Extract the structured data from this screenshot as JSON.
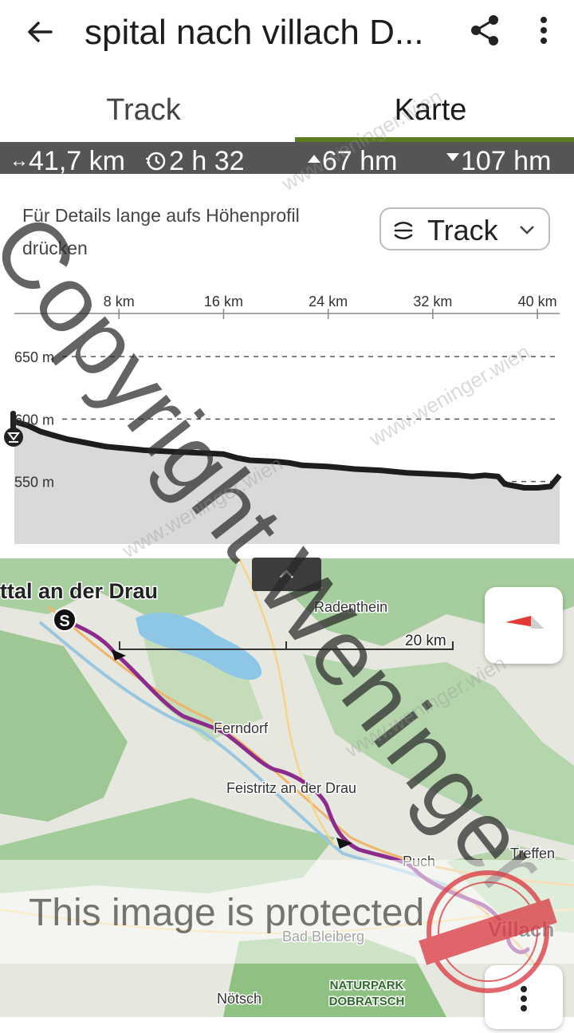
{
  "app_bar": {
    "title": "spital nach villach D...",
    "back_icon": "arrow-back-icon",
    "share_icon": "share-icon",
    "more_icon": "more-vert-icon"
  },
  "tabs": [
    {
      "label": "Track",
      "selected": false
    },
    {
      "label": "Karte",
      "selected": true
    }
  ],
  "stats": {
    "distance": "41,7 km",
    "duration": "2 h 32",
    "ascent": "67 hm",
    "descent": "107 hm"
  },
  "profile_hint": {
    "line1": "Für Details lange aufs Höhenprofil",
    "line2": "drücken"
  },
  "profile_mode": {
    "label": "Track"
  },
  "chart_data": {
    "type": "area",
    "xlabel": "",
    "ylabel": "",
    "x_unit": "km",
    "x_ticks": [
      "8 km",
      "16 km",
      "24 km",
      "32 km",
      "40 km"
    ],
    "y_ticks": [
      "650 m",
      "600 m",
      "550 m"
    ],
    "xlim": [
      0,
      41.7
    ],
    "ylim": [
      500,
      680
    ],
    "x": [
      0,
      1,
      2,
      3,
      4,
      5,
      6,
      7,
      8,
      9,
      10,
      12,
      14,
      16,
      17,
      18,
      20,
      21,
      22,
      24,
      25,
      26,
      28,
      30,
      32,
      34,
      35,
      36,
      37,
      37.5,
      38,
      39,
      40,
      41,
      41.7
    ],
    "elevation": [
      598,
      595,
      590,
      587,
      584,
      582,
      580,
      578,
      577,
      576,
      575,
      574,
      573,
      572,
      569,
      567,
      566,
      565,
      563,
      562,
      561,
      560,
      559,
      557,
      556,
      555,
      554,
      555,
      554,
      548,
      547,
      545,
      545,
      546,
      555
    ]
  },
  "map": {
    "labels": {
      "start_town": "ttal an der Drau",
      "radenthein": "Radenthein",
      "ferndorf": "Ferndorf",
      "feistritz": "Feistritz an der Drau",
      "puch": "Puch",
      "treffen": "Treffen",
      "bad_bleiberg": "Bad Bleiberg",
      "villach": "Villach",
      "noetsch": "Nötsch",
      "naturpark_1": "NATURPARK",
      "naturpark_2": "DOBRATSCH",
      "start_marker": "S"
    },
    "scale_label": "20 km"
  },
  "watermarks": {
    "copyright": "Copyright Weninger",
    "protected": "This image is protected",
    "site": "www.weninger.wien"
  },
  "colors": {
    "accent": "#5c7a22",
    "route": "#8b2c8c",
    "stats_bg": "#555555",
    "profile_fill": "#d9d9d9"
  }
}
